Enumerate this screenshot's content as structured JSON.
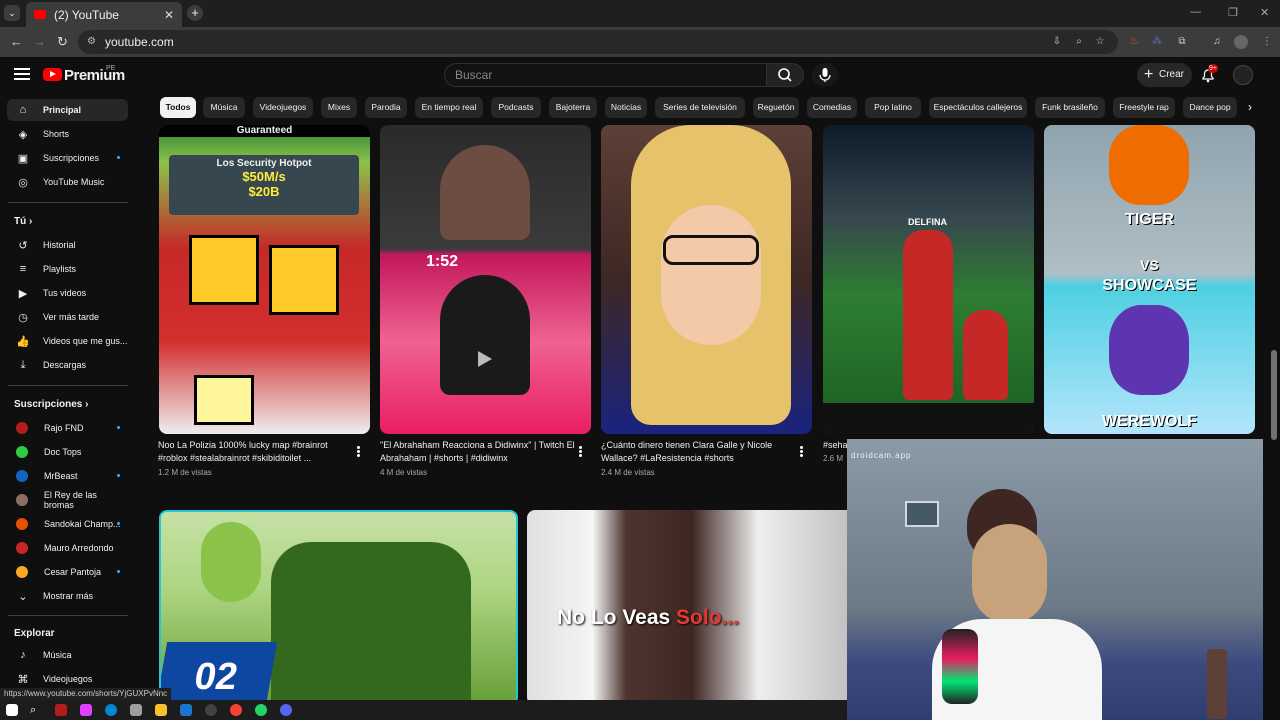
{
  "browser": {
    "tab_title": "(2) YouTube",
    "url": "youtube.com",
    "tab_close": "✕",
    "new_tab": "+",
    "tab_menu": "⌄"
  },
  "header": {
    "logo_text": "Premium",
    "logo_country": "PE",
    "search_placeholder": "Buscar",
    "create_label": "Crear",
    "notification_count": "9+"
  },
  "sidebar": {
    "main": [
      {
        "label": "Principal",
        "icon": "home-icon",
        "glyph": "⌂"
      },
      {
        "label": "Shorts",
        "icon": "shorts-icon",
        "glyph": "◈"
      },
      {
        "label": "Suscripciones",
        "icon": "subscriptions-icon",
        "glyph": "▣"
      },
      {
        "label": "YouTube Music",
        "icon": "music-icon",
        "glyph": "◎"
      }
    ],
    "you_heading": "Tú",
    "you": [
      {
        "label": "Historial",
        "icon": "history-icon",
        "glyph": "↺"
      },
      {
        "label": "Playlists",
        "icon": "playlists-icon",
        "glyph": "≡"
      },
      {
        "label": "Tus videos",
        "icon": "your-videos-icon",
        "glyph": "▶"
      },
      {
        "label": "Ver más tarde",
        "icon": "watch-later-icon",
        "glyph": "◷"
      },
      {
        "label": "Videos que me gus...",
        "icon": "liked-icon",
        "glyph": "👍"
      },
      {
        "label": "Descargas",
        "icon": "downloads-icon",
        "glyph": "⤓"
      }
    ],
    "subs_heading": "Suscripciones",
    "subs": [
      {
        "label": "Rajo FND",
        "color": "#b71c1c"
      },
      {
        "label": "Doc Tops",
        "color": "#2ecc40"
      },
      {
        "label": "MrBeast",
        "color": "#1565c0"
      },
      {
        "label": "El Rey de las bromas",
        "color": "#8d6e63"
      },
      {
        "label": "Sandokai Champ...",
        "color": "#e65100"
      },
      {
        "label": "Mauro Arredondo",
        "color": "#c62828"
      },
      {
        "label": "Cesar Pantoja",
        "color": "#f9a825"
      }
    ],
    "show_more": "Mostrar más",
    "explore_heading": "Explorar",
    "explore": [
      {
        "label": "Música",
        "icon": "music-note-icon",
        "glyph": "♪"
      },
      {
        "label": "Videojuegos",
        "icon": "gaming-icon",
        "glyph": "⌘"
      }
    ]
  },
  "chips": [
    "Todos",
    "Música",
    "Videojuegos",
    "Mixes",
    "Parodia",
    "En tiempo real",
    "Podcasts",
    "Bajoterra",
    "Noticias",
    "Series de televisión",
    "Reguetón",
    "Comedias",
    "Pop latino",
    "Espectáculos callejeros",
    "Funk brasileño",
    "Freestyle rap",
    "Dance pop"
  ],
  "shorts": [
    {
      "title": "Noo La Polizia 1000% lucky map #brainrot #roblox #stealabrainrot #skibiditoilet ...",
      "views": "1.2 M de vistas",
      "thumb_text": [
        "Guaranteed",
        "Los Security Hotpot",
        "$50M/s",
        "$20B"
      ]
    },
    {
      "title": "\"El Abrahaham Reacciona a Didiwinx\" | Twitch El Abrahaham | #shorts | #didiwinx",
      "views": "4 M de vistas",
      "thumb_text": [
        "1:52"
      ]
    },
    {
      "title": "¿Cuánto dinero tienen Clara Galle y Nicole Wallace? #LaResistencia #shorts",
      "views": "2.4 M de vistas",
      "thumb_text": []
    },
    {
      "title": "#seha",
      "views": "2.6 M",
      "thumb_text": [
        "DELFINA"
      ]
    },
    {
      "title": "",
      "views": "",
      "thumb_text": [
        "TIGER",
        "VS",
        "SHOWCASE",
        "WEREWOLF"
      ]
    }
  ],
  "videos": [
    {
      "thumb_text": "02"
    },
    {
      "thumb_text": "No Lo Veas ",
      "thumb_text_red": "Solo..."
    }
  ],
  "webcam_overlay": "droidcam.app",
  "status_url": "https://www.youtube.com/shorts/YjGUXPvNnc",
  "colors": {
    "yt_red": "#ff0000",
    "chip_selected": "#f1f1f1",
    "background": "#0f0f0f"
  }
}
